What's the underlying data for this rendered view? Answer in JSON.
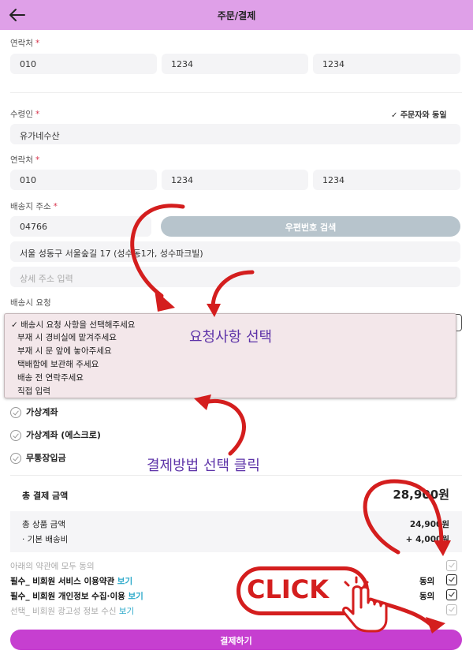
{
  "header": {
    "title": "주문/결제"
  },
  "orderer": {
    "contact_label": "연락처",
    "required_mark": "*",
    "phone": [
      "010",
      "1234",
      "1234"
    ]
  },
  "recipient": {
    "name_label": "수령인",
    "same_as_orderer": "✓ 주문자와 동일",
    "name": "유가네수산",
    "contact_label": "연락처",
    "phone": [
      "010",
      "1234",
      "1234"
    ],
    "address_label": "배송지 주소",
    "zipcode": "04766",
    "zip_button": "우편번호 검색",
    "address": "서울 성동구 서울숲길 17 (성수동1가, 성수파크빌)",
    "detail_placeholder": "상세 주소 입력",
    "request_label": "배송시 요청"
  },
  "request_dropdown": {
    "selected": "✓ 배송시 요청 사항을 선택해주세요",
    "options": [
      "부재 시 경비실에 맡겨주세요",
      "부재 시 문 앞에 놓아주세요",
      "택배함에 보관해 주세요",
      "배송 전 연락주세요",
      "직접 입력"
    ]
  },
  "payment_methods": [
    "가상계좌",
    "가상계좌 (에스크로)",
    "무통장입금"
  ],
  "annotations": {
    "request": "요청사항 선택",
    "payment": "결제방법 선택 클릭",
    "click": "CLICK"
  },
  "summary": {
    "total_label": "총 결제 금액",
    "total_value": "28,900원",
    "product_label": "총 상품 금액",
    "product_value": "24,900원",
    "shipping_label": "· 기본 배송비",
    "shipping_value": "+ 4,000원"
  },
  "terms": {
    "all_label": "아래의 약관에 모두 동의",
    "see": "보기",
    "agree": "동의",
    "items": [
      {
        "label": "필수_ 비회원 서비스 이용약관",
        "agree": true
      },
      {
        "label": "필수_ 비회원 개인정보 수집·이용",
        "agree": true
      },
      {
        "label": "선택_ 비회원 광고성 정보 수신",
        "agree": false
      }
    ]
  },
  "pay_button": "결제하기",
  "colors": {
    "header": "#dfa0e8",
    "pay_button": "#c63fd0",
    "zip_button": "#b7c4cc",
    "annotation_arrow": "#d41e1e",
    "annotation_text": "#5d33a8",
    "link": "#29a8c9"
  }
}
